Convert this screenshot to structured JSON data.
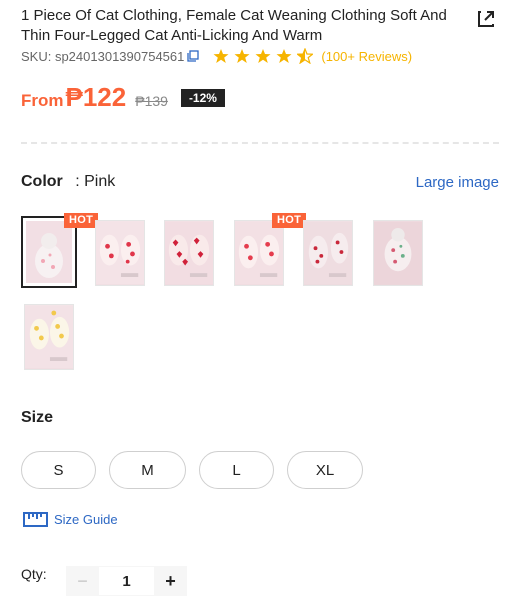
{
  "product": {
    "title": "1 Piece Of Cat Clothing, Female Cat Weaning Clothing Soft And Thin Four-Legged Cat Anti-Licking And Warm",
    "sku_label": "SKU: sp2401301390754561",
    "rating": 4.5,
    "reviews": "(100+ Reviews)"
  },
  "price": {
    "from_label": "From",
    "current": "₱122",
    "original": "₱139",
    "discount": "-12%"
  },
  "color": {
    "label": "Color",
    "separator_value": ": Pink",
    "large_image_link": "Large image",
    "hot_badge": "HOT",
    "swatches": [
      {
        "pattern": "pink-plain",
        "hot": true,
        "selected": true
      },
      {
        "pattern": "strawberry",
        "hot": false,
        "selected": false
      },
      {
        "pattern": "red-hearts",
        "hot": false,
        "selected": false
      },
      {
        "pattern": "strawberry-hot",
        "hot": true,
        "selected": false
      },
      {
        "pattern": "cherry",
        "hot": false,
        "selected": false
      },
      {
        "pattern": "floral",
        "hot": false,
        "selected": false
      },
      {
        "pattern": "yellow-floral",
        "hot": false,
        "selected": false
      }
    ]
  },
  "size": {
    "label": "Size",
    "options": [
      "S",
      "M",
      "L",
      "XL"
    ],
    "guide_link": "Size Guide"
  },
  "quantity": {
    "label": "Qty:",
    "value": "1",
    "minus": "−",
    "plus": "+"
  },
  "colors": {
    "accent": "#fa6338",
    "link": "#2d68c4",
    "star": "#f6b400"
  }
}
